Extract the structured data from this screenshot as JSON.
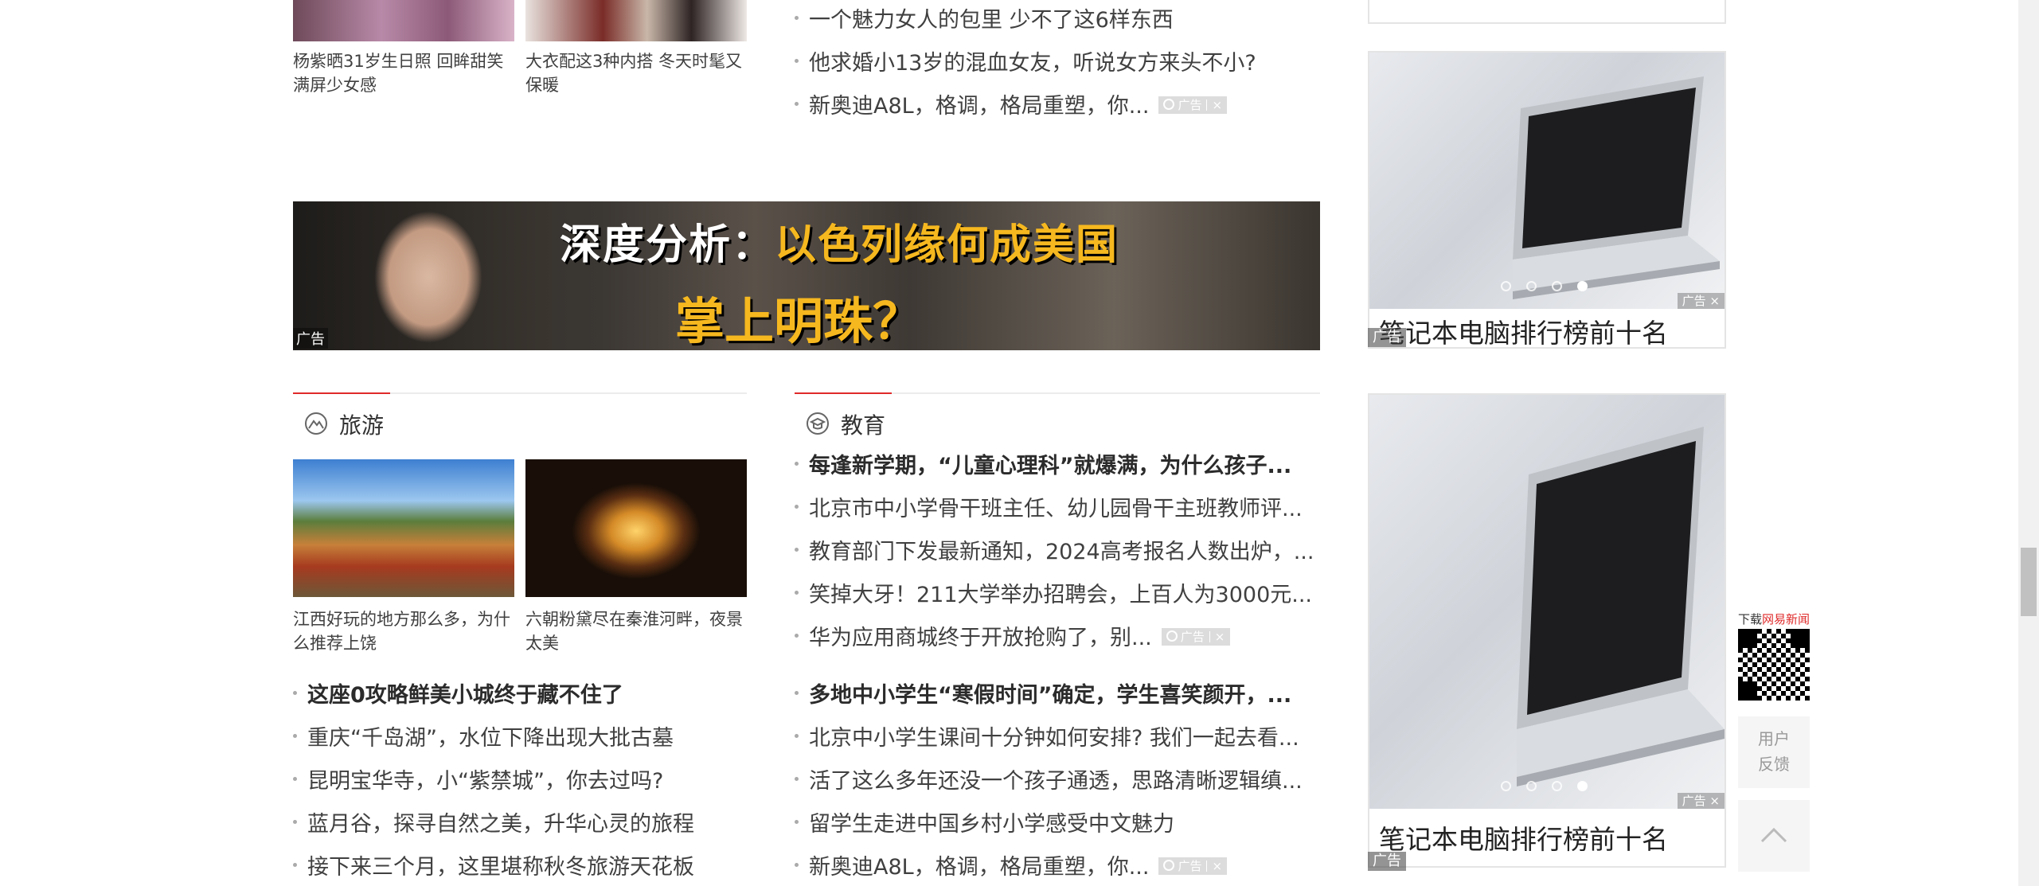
{
  "top_left": {
    "captions": [
      "杨紫晒31岁生日照 回眸甜笑满屏少女感",
      "大衣配这3种内搭 冬天时髦又保暖"
    ]
  },
  "top_list": [
    {
      "text": "一个魅力女人的包里 少不了这6样东西",
      "ad": false
    },
    {
      "text": "他求婚小13岁的混血女友，听说女方来头不小?",
      "ad": false
    },
    {
      "text": "新奥迪A8L，格调，格局重塑，你...",
      "ad": true
    }
  ],
  "ad_label": "广告",
  "banner": {
    "line1_prefix": "深度分析：",
    "line1_highlight": "以色列缘何成美国",
    "line2": "掌上明珠？",
    "ad": "广告"
  },
  "travel": {
    "title": "旅游",
    "captions": [
      "江西好玩的地方那么多，为什么推荐上饶",
      "六朝粉黛尽在秦淮河畔，夜景太美"
    ],
    "list": [
      {
        "text": "这座0攻略鲜美小城终于藏不住了",
        "bold": true
      },
      {
        "text": "重庆“千岛湖”，水位下降出现大批古墓",
        "bold": false
      },
      {
        "text": "昆明宝华寺，小“紫禁城”，你去过吗?",
        "bold": false
      },
      {
        "text": "蓝月谷，探寻自然之美，升华心灵的旅程",
        "bold": false
      },
      {
        "text": "接下来三个月，这里堪称秋冬旅游天花板",
        "bold": false
      }
    ]
  },
  "education": {
    "title": "教育",
    "list_top": [
      {
        "text": "每逢新学期，“儿童心理科”就爆满，为什么孩子...",
        "bold": true,
        "ad": false
      },
      {
        "text": "北京市中小学骨干班主任、幼儿园骨干主班教师评...",
        "bold": false,
        "ad": false
      },
      {
        "text": "教育部门下发最新通知，2024高考报名人数出炉，...",
        "bold": false,
        "ad": false
      },
      {
        "text": "笑掉大牙！211大学举办招聘会，上百人为3000元...",
        "bold": false,
        "ad": false
      },
      {
        "text": "华为应用商城终于开放抢购了，别...",
        "bold": false,
        "ad": true
      }
    ],
    "list_bottom": [
      {
        "text": "多地中小学生“寒假时间”确定，学生喜笑颜开，...",
        "bold": true,
        "ad": false
      },
      {
        "text": "北京中小学生课间十分钟如何安排? 我们一起去看...",
        "bold": false,
        "ad": false
      },
      {
        "text": "活了这么多年还没一个孩子通透，思路清晰逻辑缜...",
        "bold": false,
        "ad": false
      },
      {
        "text": "留学生走进中国乡村小学感受中文魅力",
        "bold": false,
        "ad": false
      },
      {
        "text": "新奥迪A8L，格调，格局重塑，你...",
        "bold": false,
        "ad": true
      }
    ]
  },
  "sidebar": {
    "card1_title": "笔记本电脑排行榜前十名",
    "card2_title": "笔记本电脑排行榜前十名",
    "slider_dots": 4,
    "active_dot": 3
  },
  "float_tools": {
    "qr_label_prefix": "下载",
    "qr_label_brand": "网易新闻",
    "feedback_line1": "用户",
    "feedback_line2": "反馈"
  },
  "colors": {
    "accent_red": "#e02a2a",
    "banner_yellow": "#f6b81f"
  }
}
